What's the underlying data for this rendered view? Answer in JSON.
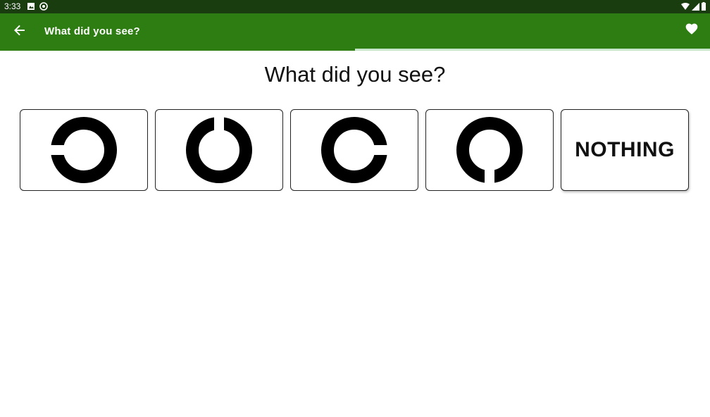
{
  "status_bar": {
    "time": "3:33",
    "left_icons": [
      "photo-icon",
      "sync-icon"
    ],
    "right_icons": [
      "wifi-icon",
      "signal-icon",
      "battery-icon"
    ]
  },
  "app_bar": {
    "back_icon": "arrow-left-icon",
    "title": "What did you see?",
    "favorite_icon": "heart-icon",
    "color": "#2e7d12"
  },
  "progress": {
    "value_percent": 50
  },
  "question": "What did you see?",
  "options": [
    {
      "id": "gap-left",
      "icon": "landolt-c-gap-left-icon"
    },
    {
      "id": "gap-top",
      "icon": "landolt-c-gap-top-icon"
    },
    {
      "id": "gap-right",
      "icon": "landolt-c-gap-right-icon"
    },
    {
      "id": "gap-bottom",
      "icon": "landolt-c-gap-bottom-icon"
    },
    {
      "id": "nothing",
      "label": "NOTHING"
    }
  ]
}
